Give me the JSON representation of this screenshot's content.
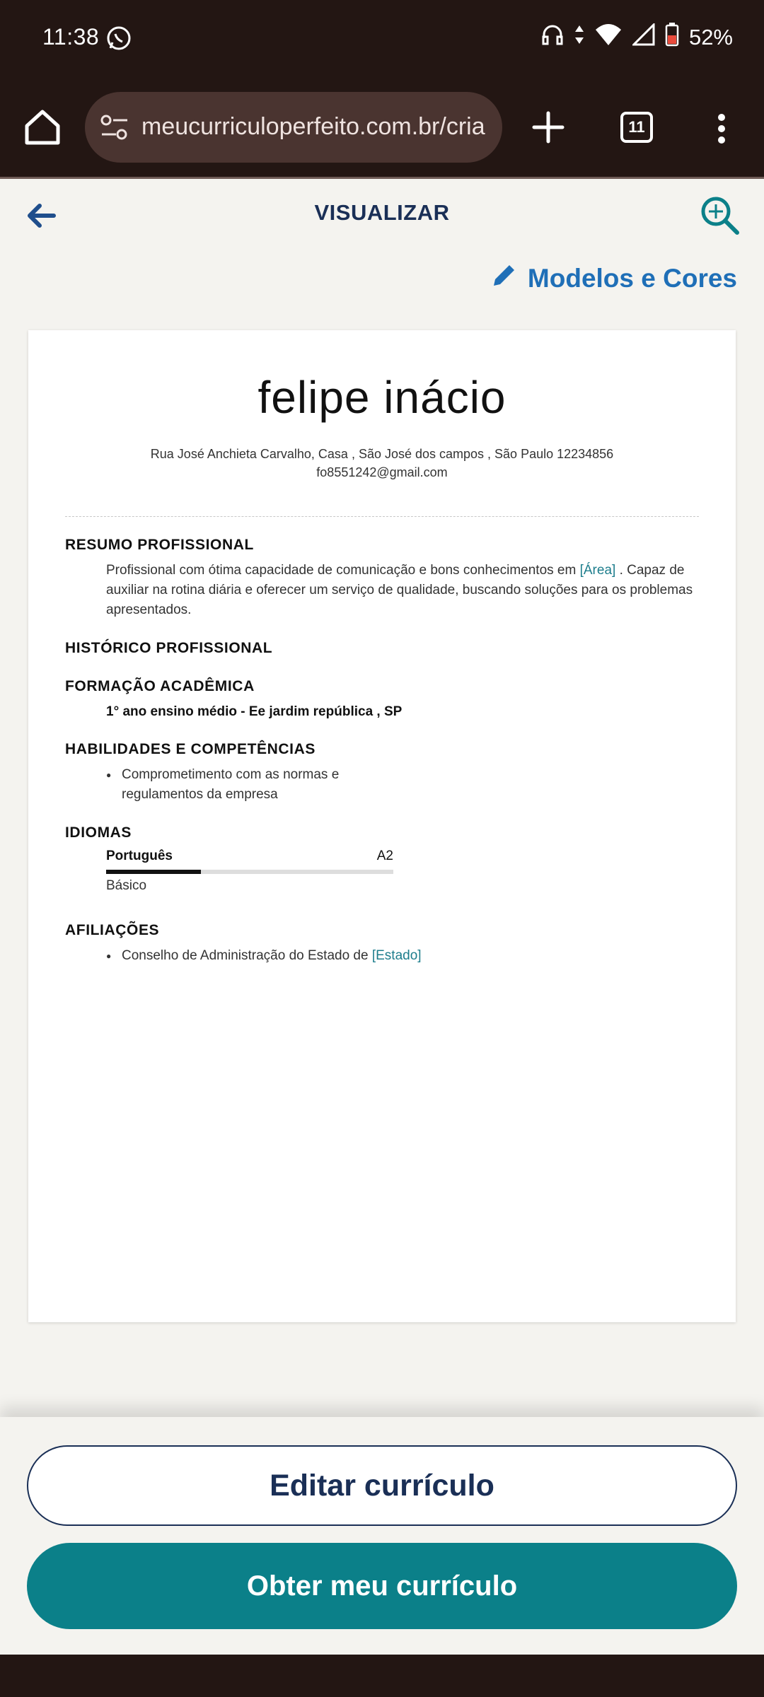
{
  "status_bar": {
    "time": "11:38",
    "battery": "52%"
  },
  "browser": {
    "url": "meucurriculoperfeito.com.br/cria",
    "tab_count": "11"
  },
  "header": {
    "title": "VISUALIZAR",
    "modelos_label": "Modelos e Cores"
  },
  "resume": {
    "name": "felipe inácio",
    "address": "Rua José Anchieta Carvalho, Casa , São José dos campos , São Paulo 12234856",
    "email": "fo8551242@gmail.com",
    "sections": {
      "resumo": {
        "title": "RESUMO PROFISSIONAL",
        "text_a": "Profissional com ótima capacidade de comunicação e bons conhecimentos em ",
        "link": "[Área]",
        "text_b": " . Capaz de auxiliar na rotina diária e oferecer um serviço de qualidade, buscando soluções para os problemas apresentados."
      },
      "historico": {
        "title": "HISTÓRICO PROFISSIONAL"
      },
      "formacao": {
        "title": "FORMAÇÃO ACADÊMICA",
        "item": "1° ano ensino médio - Ee jardim república , SP"
      },
      "habilidades": {
        "title": "HABILIDADES E COMPETÊNCIAS",
        "items": [
          "Comprometimento com as normas e regulamentos da empresa"
        ]
      },
      "idiomas": {
        "title": "IDIOMAS",
        "language": "Português",
        "code": "A2",
        "level_label": "Básico",
        "level_fraction": 0.33
      },
      "afiliacoes": {
        "title": "AFILIAÇÕES",
        "item_text": "Conselho de Administração do Estado de ",
        "item_link": "[Estado]"
      }
    }
  },
  "actions": {
    "edit_label": "Editar currículo",
    "get_label": "Obter meu currículo"
  },
  "colors": {
    "navy": "#1a2f56",
    "teal": "#0b8089",
    "link_blue": "#1f6fb7",
    "chrome_bg": "#231613"
  }
}
